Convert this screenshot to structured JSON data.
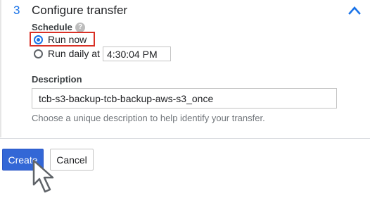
{
  "step": {
    "number": "3",
    "title": "Configure transfer",
    "collapse_icon": "chevron-up-icon"
  },
  "schedule": {
    "label": "Schedule",
    "help_icon": "help-icon",
    "help_glyph": "?",
    "options": [
      {
        "label": "Run now",
        "selected": true
      },
      {
        "label": "Run daily at",
        "selected": false
      }
    ],
    "daily_time": "4:30:04 PM"
  },
  "description": {
    "label": "Description",
    "value": "tcb-s3-backup-tcb-backup-aws-s3_once",
    "hint": "Choose a unique description to help identify your transfer."
  },
  "actions": {
    "create_label": "Create",
    "cancel_label": "Cancel"
  },
  "colors": {
    "accent": "#1a73e8",
    "primary_button": "#3367d6",
    "highlight": "#d93025"
  },
  "pointer_icon": "mouse-cursor-icon"
}
